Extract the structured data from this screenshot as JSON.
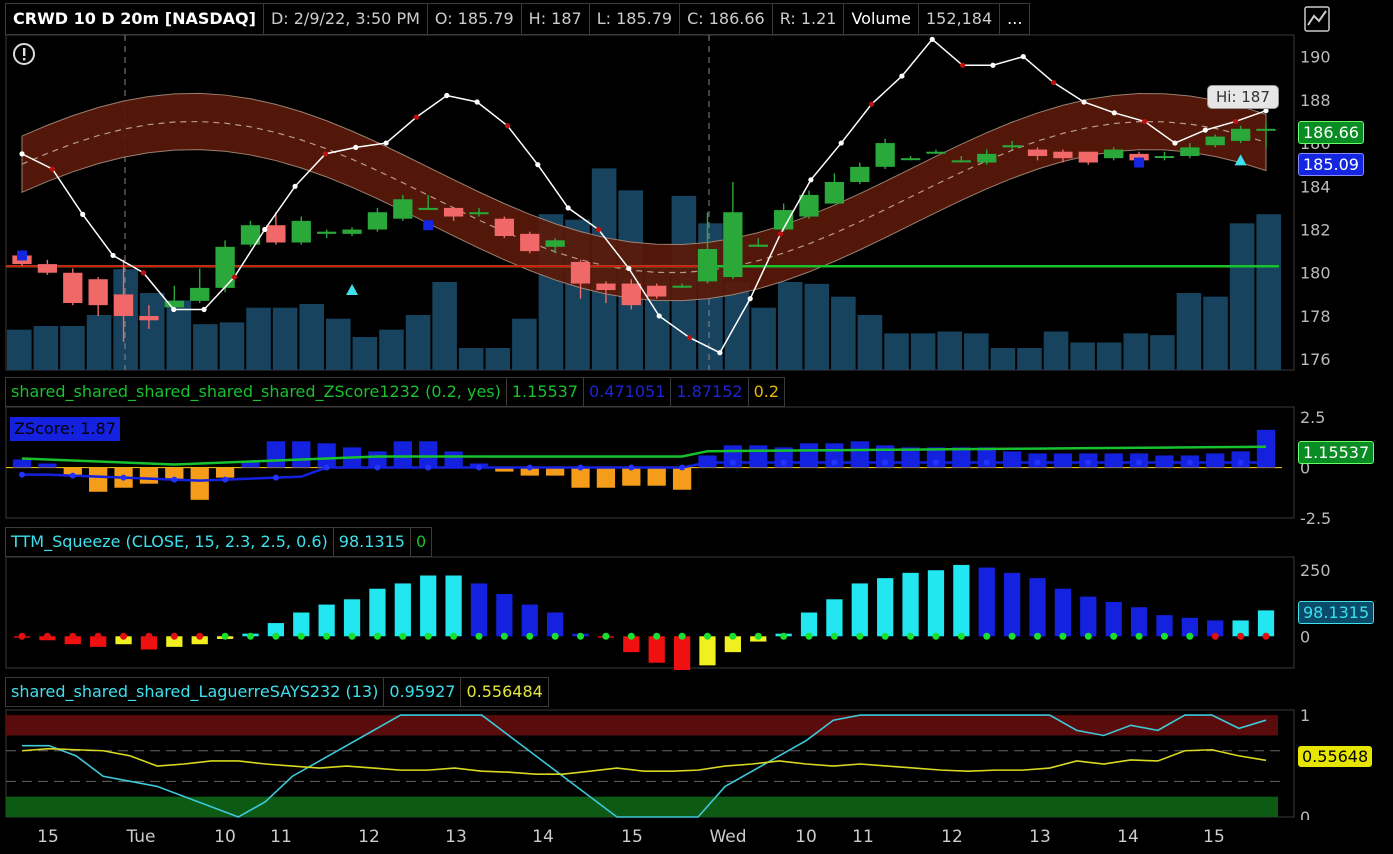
{
  "header": {
    "symbol": "CRWD 10 D 20m [NASDAQ]",
    "date": "D: 2/9/22, 3:50 PM",
    "open": "O: 185.79",
    "high": "H: 187",
    "low": "L: 185.79",
    "close": "C: 186.66",
    "range": "R: 1.21",
    "volume_label": "Volume",
    "volume_value": "152,184",
    "more": "..."
  },
  "price_panel": {
    "hi_tooltip": "Hi: 187",
    "last_badge": "186.66",
    "avg_badge": "185.09",
    "y_ticks": [
      "190",
      "188",
      "186",
      "184",
      "182",
      "180",
      "178",
      "176"
    ]
  },
  "zscore_panel": {
    "title": "shared_shared_shared_shared_shared_ZScore1232 (0.2, yes)",
    "v1": "1.15537",
    "v2": "0.471051",
    "v3": "1.87152",
    "v4": "0.2",
    "label": "ZScore: 1.87",
    "badge": "1.15537",
    "y_ticks": [
      "2.5",
      "0",
      "-2.5"
    ]
  },
  "squeeze_panel": {
    "title": "TTM_Squeeze (CLOSE, 15, 2.3, 2.5, 0.6)",
    "v1": "98.1315",
    "v2": "0",
    "badge": "98.1315",
    "y_ticks": [
      "250",
      "0"
    ]
  },
  "laguerre_panel": {
    "title": "shared_shared_shared_LaguerreSAYS232 (13)",
    "v1": "0.95927",
    "v2": "0.556484",
    "badge": "0.55648",
    "y_ticks": [
      "1",
      "0"
    ]
  },
  "x_axis": {
    "labels": [
      "15",
      "Tue",
      "10",
      "11",
      "12",
      "13",
      "14",
      "15",
      "Wed",
      "10",
      "11",
      "12",
      "13",
      "14",
      "15"
    ]
  },
  "chart_data": [
    {
      "type": "candlestick",
      "name_shown": "CRWD 10 D 20m [NASDAQ]",
      "ylim": [
        175.5,
        191
      ],
      "open": [
        180.8,
        180.4,
        180.0,
        179.7,
        179.0,
        178.0,
        178.4,
        178.7,
        179.3,
        181.3,
        182.2,
        181.4,
        181.8,
        181.8,
        182.0,
        182.5,
        183.0,
        183.0,
        182.8,
        182.5,
        181.8,
        181.2,
        180.5,
        179.5,
        179.5,
        179.4,
        179.4,
        179.6,
        179.8,
        181.2,
        182.0,
        182.6,
        183.2,
        184.2,
        184.9,
        185.3,
        185.6,
        185.2,
        185.1,
        185.8,
        185.7,
        185.6,
        185.6,
        185.3,
        185.5,
        185.4,
        185.4,
        185.9,
        186.1,
        186.66
      ],
      "close": [
        180.4,
        180.0,
        178.6,
        178.5,
        178.0,
        177.8,
        178.7,
        179.3,
        181.2,
        182.2,
        181.4,
        182.4,
        181.9,
        182.0,
        182.8,
        183.4,
        183.0,
        182.6,
        182.8,
        181.7,
        181.0,
        181.5,
        179.5,
        179.2,
        178.5,
        178.9,
        179.4,
        181.1,
        182.8,
        181.3,
        182.9,
        183.6,
        184.2,
        184.9,
        186.0,
        185.3,
        185.6,
        185.2,
        185.5,
        185.9,
        185.4,
        185.3,
        185.1,
        185.7,
        185.2,
        185.4,
        185.8,
        186.3,
        186.66,
        186.66
      ],
      "high": [
        180.9,
        180.6,
        180.2,
        179.8,
        180.6,
        178.5,
        179.4,
        180.2,
        181.5,
        182.4,
        182.8,
        182.6,
        182.0,
        182.1,
        183.0,
        183.6,
        183.6,
        183.0,
        183.0,
        182.6,
        181.9,
        181.6,
        180.6,
        179.6,
        179.7,
        179.5,
        179.5,
        182.8,
        184.2,
        181.6,
        183.2,
        183.8,
        184.6,
        185.1,
        186.2,
        185.4,
        185.7,
        185.4,
        185.7,
        186.1,
        185.8,
        185.7,
        185.6,
        185.8,
        185.6,
        185.6,
        186.0,
        186.4,
        186.8,
        187.0
      ],
      "low": [
        180.3,
        179.9,
        178.5,
        178.0,
        176.8,
        177.4,
        178.2,
        178.6,
        179.1,
        181.2,
        181.3,
        181.3,
        181.6,
        181.7,
        181.9,
        182.4,
        182.9,
        182.4,
        182.6,
        181.6,
        180.9,
        180.9,
        178.8,
        178.6,
        178.3,
        178.8,
        179.3,
        179.5,
        179.7,
        181.2,
        181.9,
        182.5,
        183.2,
        184.1,
        184.8,
        185.2,
        185.5,
        185.1,
        185.0,
        185.7,
        185.2,
        185.1,
        185.0,
        185.2,
        185.1,
        185.2,
        185.3,
        185.8,
        186.0,
        185.79
      ],
      "volume": [
        22,
        24,
        24,
        30,
        55,
        42,
        38,
        25,
        26,
        34,
        34,
        36,
        28,
        18,
        22,
        30,
        48,
        12,
        12,
        28,
        85,
        82,
        110,
        98,
        58,
        95,
        80,
        48,
        34,
        48,
        47,
        40,
        30,
        20,
        20,
        21,
        20,
        12,
        12,
        21,
        15,
        15,
        20,
        19,
        42,
        40,
        80,
        85
      ]
    },
    {
      "type": "bar",
      "name_shown": "ZScore",
      "ylim": [
        -2.5,
        3
      ],
      "values": [
        0.4,
        0.2,
        -0.4,
        -1.2,
        -1.0,
        -0.8,
        -0.6,
        -1.6,
        -0.5,
        0.3,
        1.3,
        1.3,
        1.2,
        1.0,
        0.8,
        1.3,
        1.3,
        0.8,
        0.2,
        -0.2,
        -0.4,
        -0.4,
        -1.0,
        -1.0,
        -0.9,
        -0.9,
        -1.1,
        0.6,
        1.1,
        1.1,
        1.0,
        1.2,
        1.2,
        1.3,
        1.1,
        1.0,
        1.0,
        1.0,
        1.0,
        0.8,
        0.7,
        0.7,
        0.7,
        0.7,
        0.7,
        0.6,
        0.6,
        0.7,
        0.8,
        1.87
      ]
    },
    {
      "type": "bar",
      "name_shown": "TTM_Squeeze",
      "ylim": [
        -120,
        300
      ],
      "values": [
        -5,
        -15,
        -30,
        -40,
        -30,
        -50,
        -40,
        -30,
        -10,
        10,
        50,
        90,
        120,
        140,
        180,
        200,
        230,
        230,
        200,
        160,
        120,
        90,
        10,
        -5,
        -60,
        -100,
        -130,
        -110,
        -60,
        -20,
        10,
        90,
        140,
        200,
        220,
        240,
        250,
        270,
        260,
        240,
        220,
        180,
        150,
        130,
        110,
        80,
        70,
        60,
        60,
        98.1315
      ]
    },
    {
      "type": "line",
      "name_shown": "LaguerreSAYS232",
      "ylim": [
        0,
        1.05
      ],
      "series": [
        {
          "name": "0.95927",
          "values": [
            0.7,
            0.7,
            0.6,
            0.4,
            0.35,
            0.3,
            0.2,
            0.1,
            0.0,
            0.15,
            0.4,
            0.55,
            0.7,
            0.85,
            1.0,
            1.0,
            1.0,
            1.0,
            0.8,
            0.6,
            0.4,
            0.2,
            0.0,
            0.0,
            0.0,
            0.0,
            0.3,
            0.45,
            0.6,
            0.75,
            0.95,
            1.0,
            1.0,
            1.0,
            1.0,
            1.0,
            1.0,
            1.0,
            1.0,
            0.85,
            0.8,
            0.9,
            0.85,
            1.0,
            1.0,
            0.87,
            0.95
          ]
        },
        {
          "name": "0.556484",
          "values": [
            0.65,
            0.67,
            0.66,
            0.65,
            0.6,
            0.5,
            0.52,
            0.55,
            0.55,
            0.52,
            0.5,
            0.48,
            0.5,
            0.48,
            0.46,
            0.46,
            0.48,
            0.45,
            0.44,
            0.42,
            0.42,
            0.45,
            0.48,
            0.45,
            0.45,
            0.46,
            0.5,
            0.52,
            0.55,
            0.52,
            0.5,
            0.52,
            0.5,
            0.48,
            0.46,
            0.45,
            0.46,
            0.46,
            0.48,
            0.55,
            0.52,
            0.56,
            0.55,
            0.65,
            0.66,
            0.6,
            0.556
          ]
        }
      ]
    }
  ]
}
